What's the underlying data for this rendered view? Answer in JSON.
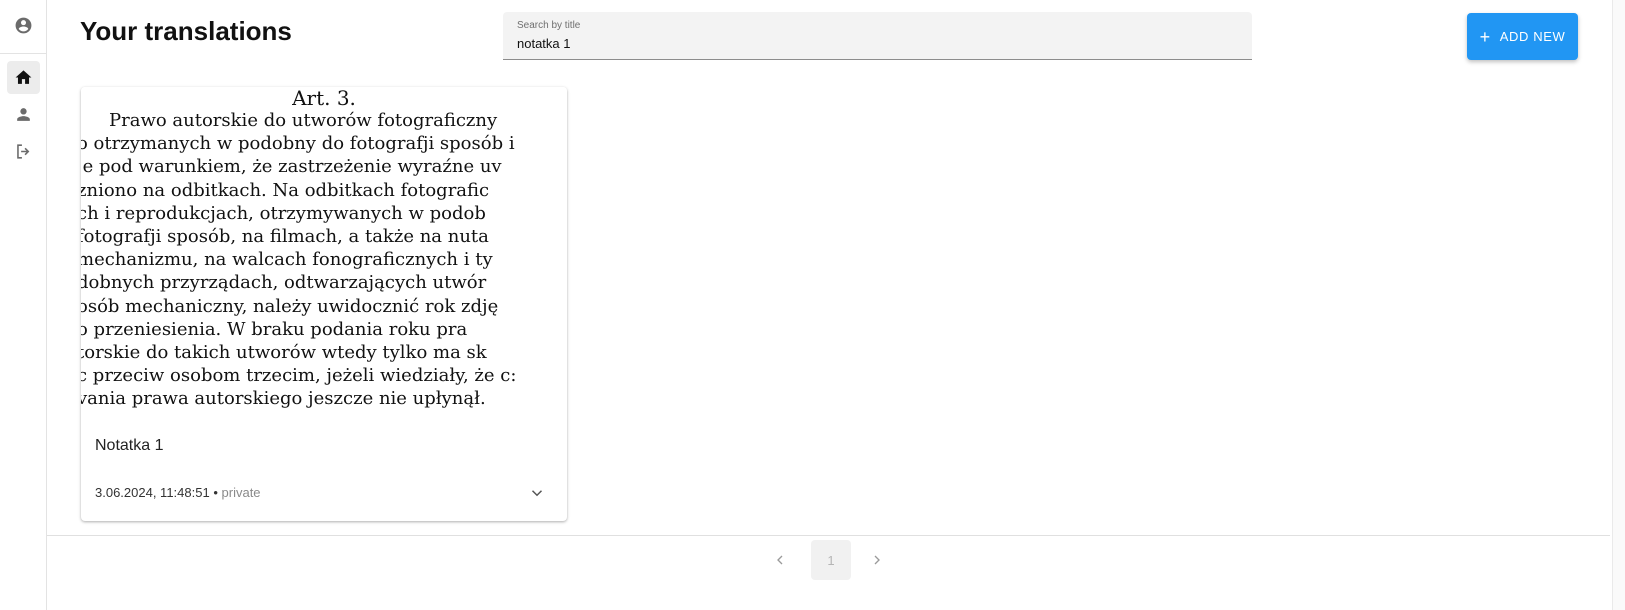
{
  "sidebar": {
    "items": [
      {
        "icon": "account-circle-icon",
        "label": "Account"
      },
      {
        "icon": "home-icon",
        "label": "Home",
        "active": true
      },
      {
        "icon": "person-icon",
        "label": "Profile"
      },
      {
        "icon": "logout-icon",
        "label": "Logout"
      }
    ]
  },
  "header": {
    "title": "Your translations",
    "search": {
      "label": "Search by title",
      "value": "notatka 1"
    },
    "add_button": {
      "icon": "+",
      "label": "ADD NEW"
    }
  },
  "cards": [
    {
      "thumbnail_text": {
        "heading": "Art. 3.",
        "lines": [
          "Prawo autorskie do utworów  fotograficzny",
          "o otrzymanych w podobny do fotografji sposób i",
          "je pod warunkiem, że zastrzeżenie wyraźne uv",
          "zniono na odbitkach. Na odbitkach fotografic",
          "ch i reprodukcjach, otrzymywanych w podob",
          " fotografji sposób, na filmach, a także na nuta",
          " mechanizmu, na walcach fonograficznych i ty",
          "dobnych przyrządach, odtwarzających utwór",
          "osób mechaniczny, należy uwidocznić rok zdję",
          "o przeniesienia. W braku podania roku pra",
          "torskie do takich utworów wtedy tylko ma sk",
          "c przeciw osobom trzecim, jeżeli wiedziały, że c:",
          "vania prawa autorskiego jeszcze nie upłynął."
        ]
      },
      "title": "Notatka 1",
      "date": "3.06.2024, 11:48:51",
      "separator": "•",
      "visibility": "private"
    }
  ],
  "pagination": {
    "current": "1"
  }
}
